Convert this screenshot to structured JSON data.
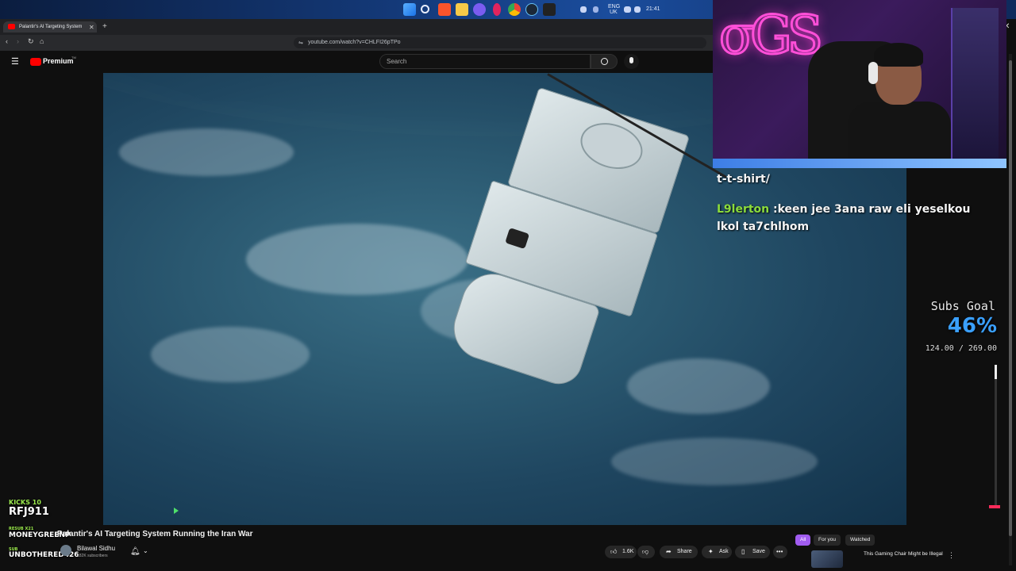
{
  "browser": {
    "tab_title": "Palantir's AI Targeting System",
    "url": "youtube.com/watch?v=CHLFI26pTPo"
  },
  "taskbar": {
    "lang_top": "ENG",
    "lang_bottom": "UK",
    "time": "21:41"
  },
  "youtube": {
    "logo_text": "Premium",
    "logo_super": "TM",
    "search_placeholder": "Search"
  },
  "overlay": {
    "chat_line1": "t-t-shirt/",
    "chat_user": "L9lerton",
    "chat_msg": ":keen jee 3ana raw eli yeselkou",
    "chat_msg2": "lkol ta7chlhom",
    "goal_title": "Subs Goal",
    "goal_percent": "46%",
    "goal_numbers": "124.00 / 269.00",
    "goal_fraction": 0.46,
    "kicks_label": "KICKS 10",
    "kicks_user": "RFJ911",
    "resub_label": "RESUB X21",
    "resub_user": "MONEYGREENP",
    "sub_label": "SUB",
    "sub_user": "UNBOTHERED426"
  },
  "video": {
    "title": "Palantir's AI Targeting System Running the Iran War",
    "channel": "Bilawal Sidhu",
    "subscribers": "182K subscribers",
    "likes": "1.6K",
    "share": "Share",
    "ask": "Ask",
    "save": "Save"
  },
  "sidebar_chips": {
    "all": "All",
    "for_you": "For you",
    "watched": "Watched"
  },
  "recommended": {
    "title": "This Gaming Chair Might be Illegal"
  },
  "colors": {
    "goal_accent": "#3aa0ff",
    "chat_user": "#8bdc3c",
    "webcam_logo": "#ff4fd8",
    "youtube_red": "#ff0000"
  }
}
